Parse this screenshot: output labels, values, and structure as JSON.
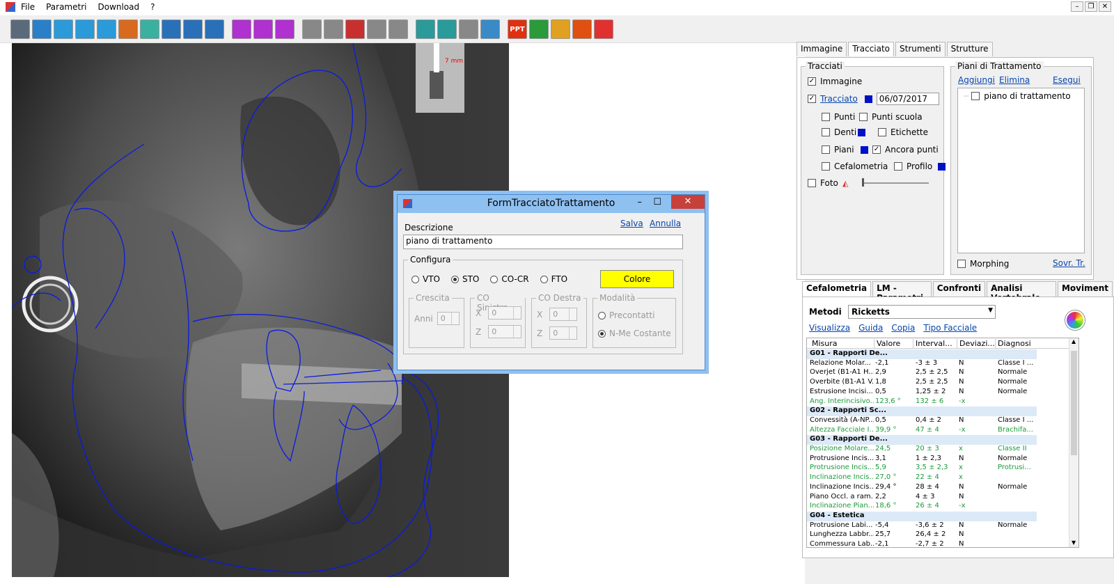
{
  "menu": [
    "File",
    "Parametri",
    "Download",
    "?"
  ],
  "toolbar": {
    "icons": [
      {
        "name": "measure-icon",
        "color": "#5a6a7a"
      },
      {
        "name": "zoom-icon",
        "color": "#2a80c8"
      },
      {
        "name": "undo-icon",
        "color": "#2a9ad8"
      },
      {
        "name": "redo-icon",
        "color": "#2a9ad8"
      },
      {
        "name": "rotate-icon",
        "color": "#2a9ad8"
      },
      {
        "name": "point-icon",
        "color": "#d86a20"
      },
      {
        "name": "point2-icon",
        "color": "#3ab0a0"
      },
      {
        "name": "patient-icon",
        "color": "#2a70b8"
      },
      {
        "name": "patient-zoom-icon",
        "color": "#2a70b8"
      },
      {
        "name": "profile-icon",
        "color": "#2a70b8"
      },
      {
        "name": "move-h-icon",
        "color": "#b030d0"
      },
      {
        "name": "move-v-icon",
        "color": "#b030d0"
      },
      {
        "name": "move-d-icon",
        "color": "#b030d0"
      },
      {
        "name": "face-icon",
        "color": "#888888"
      },
      {
        "name": "magnify-icon",
        "color": "#888888"
      },
      {
        "name": "tooth-icon",
        "color": "#c83030"
      },
      {
        "name": "skull-icon",
        "color": "#888888"
      },
      {
        "name": "eye-icon",
        "color": "#888888"
      },
      {
        "name": "print-icon",
        "color": "#2a9a9a"
      },
      {
        "name": "print2-icon",
        "color": "#2a9a9a"
      },
      {
        "name": "print3-icon",
        "color": "#888888"
      },
      {
        "name": "scan-icon",
        "color": "#3a8ac8"
      },
      {
        "name": "ppt-icon",
        "color": "#e03010"
      },
      {
        "name": "check-icon",
        "color": "#2a9a3a"
      },
      {
        "name": "download-icon",
        "color": "#e0a020"
      },
      {
        "name": "export-icon",
        "color": "#e05010"
      },
      {
        "name": "exit-icon",
        "color": "#e03030"
      }
    ],
    "ppt_label": "PPT"
  },
  "ruler_label": "7 mm",
  "right_tabs": [
    "Immagine",
    "Tracciato",
    "Strumenti",
    "Strutture"
  ],
  "tracciati": {
    "title": "Tracciati",
    "immagine": "Immagine",
    "tracciato": "Tracciato",
    "date": "06/07/2017",
    "punti": "Punti",
    "punti_scuola": "Punti scuola",
    "denti": "Denti",
    "etichette": "Etichette",
    "piani": "Piani",
    "ancora_punti": "Ancora punti",
    "cefalometria": "Cefalometria",
    "profilo": "Profilo",
    "foto": "Foto"
  },
  "piani": {
    "title": "Piani di Trattamento",
    "aggiungi": "Aggiungi",
    "elimina": "Elimina",
    "esegui": "Esegui",
    "item": "piano di trattamento",
    "morphing": "Morphing",
    "sovr": "Sovr. Tr."
  },
  "bottom_tabs": [
    "Cefalometria",
    "LM - Parametri",
    "Confronti",
    "Analisi Vertebrale",
    "Moviment"
  ],
  "metodi": {
    "label": "Metodi",
    "value": "Ricketts",
    "visualizza": "Visualizza",
    "guida": "Guida",
    "copia": "Copia",
    "tipo": "Tipo Facciale"
  },
  "grid": {
    "headers": [
      "Misura",
      "Valore",
      "Interval...",
      "Deviazi...",
      "Diagnosi"
    ],
    "rows": [
      {
        "g": true,
        "c": [
          "G01 - Rapporti De..."
        ]
      },
      {
        "c": [
          "Relazione Molar...",
          "-2,1",
          "-3 ± 3",
          "N",
          "Classe I ..."
        ]
      },
      {
        "c": [
          "Overjet (B1-A1 H...",
          "2,9",
          "2,5 ± 2,5",
          "N",
          "Normale"
        ]
      },
      {
        "c": [
          "Overbite (B1-A1 V...",
          "1,8",
          "2,5 ± 2,5",
          "N",
          "Normale"
        ]
      },
      {
        "c": [
          "Estrusione Incisi...",
          "0,5",
          "1,25 ± 2",
          "N",
          "Normale"
        ]
      },
      {
        "green": true,
        "c": [
          "Ang. Interincisivo...",
          "123,6 °",
          "132 ± 6",
          "-x",
          ""
        ]
      },
      {
        "g": true,
        "c": [
          "G02 - Rapporti Sc..."
        ]
      },
      {
        "c": [
          "Convessità (A-NP...",
          "0,5",
          "0,4 ± 2",
          "N",
          "Classe I ..."
        ]
      },
      {
        "green": true,
        "c": [
          "Altezza Facciale I...",
          "39,9 °",
          "47 ± 4",
          "-x",
          "Brachifa..."
        ]
      },
      {
        "g": true,
        "c": [
          "G03 - Rapporti De..."
        ]
      },
      {
        "green": true,
        "c": [
          "Posizione Molare...",
          "24,5",
          "20 ± 3",
          "x",
          "Classe II"
        ]
      },
      {
        "c": [
          "Protrusione Incis...",
          "3,1",
          "1 ± 2,3",
          "N",
          "Normale"
        ]
      },
      {
        "green": true,
        "c": [
          "Protrusione Incis...",
          "5,9",
          "3,5 ± 2,3",
          "x",
          "Protrusi..."
        ]
      },
      {
        "green": true,
        "c": [
          "Inclinazione Incis...",
          "27,0 °",
          "22 ± 4",
          "x",
          ""
        ]
      },
      {
        "c": [
          "Inclinazione Incis...",
          "29,4 °",
          "28 ± 4",
          "N",
          "Normale"
        ]
      },
      {
        "c": [
          "Piano Occl. a ram...",
          "2,2",
          "4 ± 3",
          "N",
          ""
        ]
      },
      {
        "green": true,
        "c": [
          "Inclinazione Pian...",
          "18,6 °",
          "26 ± 4",
          "-x",
          ""
        ]
      },
      {
        "g": true,
        "c": [
          "G04 - Estetica"
        ]
      },
      {
        "c": [
          "Protrusione Labi...",
          "-5,4",
          "-3,6 ± 2",
          "N",
          "Normale"
        ]
      },
      {
        "c": [
          "Lunghezza Labbr...",
          "25,7",
          "26,4 ± 2",
          "N",
          ""
        ]
      },
      {
        "c": [
          "Commessura Lab...",
          "-2,1",
          "-2,7 ± 2",
          "N",
          ""
        ]
      }
    ]
  },
  "dialog": {
    "title": "FormTracciatoTrattamento",
    "descrizione_label": "Descrizione",
    "salva": "Salva",
    "annulla": "Annulla",
    "descrizione_value": "piano di trattamento",
    "configura": "Configura",
    "opts": [
      "VTO",
      "STO",
      "CO-CR",
      "FTO"
    ],
    "colore": "Colore",
    "crescita": "Crescita",
    "anni": "Anni",
    "co_sinistra": "CO Sinistra",
    "co_destra": "CO Destra",
    "modalita": "Modalità",
    "x": "X",
    "z": "Z",
    "zero": "0",
    "precontatti": "Precontatti",
    "nme": "N-Me Costante"
  }
}
